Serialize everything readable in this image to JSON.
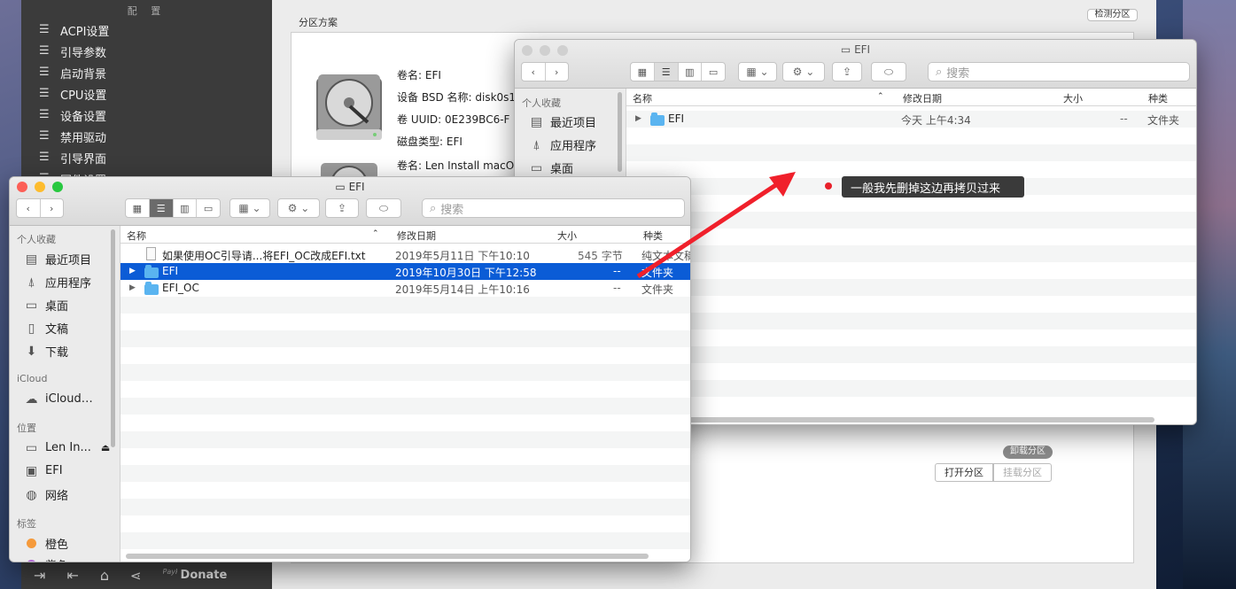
{
  "background_app": {
    "sidebar_header": "配 置",
    "sidebar_items": [
      "ACPI设置",
      "引导参数",
      "启动背景",
      "CPU设置",
      "设备设置",
      "禁用驱动",
      "引导界面",
      "固件设置"
    ],
    "partition_heading": "分区方案",
    "detect_button": "检测分区",
    "disks": [
      {
        "volume_name": "卷名: EFI",
        "bsd_label": "设备 BSD 名称:",
        "bsd_value": "disk0s1",
        "uuid_label": "卷 UUID:",
        "uuid_value": "0E239BC6-F",
        "disk_type": "磁盘类型: EFI"
      },
      {
        "volume_name": "卷名: Len Install macO"
      }
    ],
    "unmount_button": "卸载分区",
    "open_button": "打开分区",
    "mount_button": "挂载分区",
    "donate_label": "Donate",
    "paypal_label": "PayPal"
  },
  "finder_back": {
    "title": "EFI",
    "search_placeholder": "搜索",
    "sidebar_section": "个人收藏",
    "sidebar_items": [
      "最近项目",
      "应用程序",
      "桌面"
    ],
    "columns": {
      "name": "名称",
      "modified": "修改日期",
      "size": "大小",
      "kind": "种类"
    },
    "rows": [
      {
        "name": "EFI",
        "modified": "今天 上午4:34",
        "size": "--",
        "kind": "文件夹"
      }
    ]
  },
  "finder_front": {
    "title": "EFI",
    "search_placeholder": "搜索",
    "sections": {
      "favorites": "个人收藏",
      "favorites_items": [
        "最近项目",
        "应用程序",
        "桌面",
        "文稿",
        "下载"
      ],
      "icloud": "iCloud",
      "icloud_items": [
        "iCloud…"
      ],
      "locations": "位置",
      "locations_items": [
        "Len In...",
        "EFI",
        "网络"
      ],
      "tags": "标签",
      "tags_items": [
        "橙色",
        "紫色"
      ]
    },
    "columns": {
      "name": "名称",
      "modified": "修改日期",
      "size": "大小",
      "kind": "种类"
    },
    "rows": [
      {
        "name": "如果使用OC引导请...将EFI_OC改成EFI.txt",
        "modified": "2019年5月11日 下午10:10",
        "size": "545 字节",
        "kind": "纯文本文稿"
      },
      {
        "name": "EFI",
        "modified": "2019年10月30日 下午12:58",
        "size": "--",
        "kind": "文件夹"
      },
      {
        "name": "EFI_OC",
        "modified": "2019年5月14日 上午10:16",
        "size": "--",
        "kind": "文件夹"
      }
    ]
  },
  "annotation": {
    "tooltip": "一般我先删掉这边再拷贝过来",
    "arrow_color": "#f0202b"
  },
  "colors": {
    "selection": "#0b5cd6",
    "folder": "#5ab4f0",
    "red_dot": "#e8202a"
  }
}
